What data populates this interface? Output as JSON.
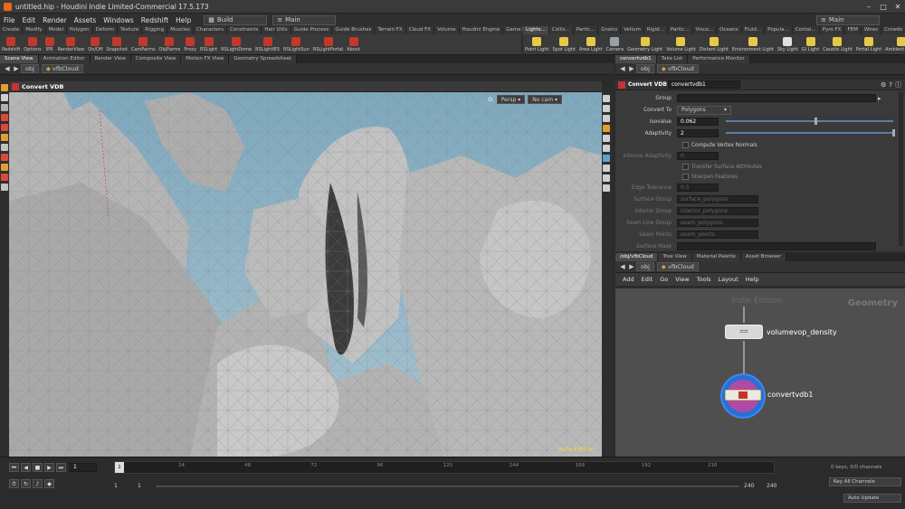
{
  "window": {
    "title": "untitled.hip - Houdini Indie Limited-Commercial 17.5.173",
    "min": "–",
    "max": "□",
    "close": "✕"
  },
  "menubar": {
    "items": [
      "File",
      "Edit",
      "Render",
      "Assets",
      "Windows",
      "Redshift",
      "Help"
    ],
    "desktop": "Build",
    "context_left": "Main",
    "context_right": "Main"
  },
  "shelf_left": {
    "tabs": [
      "Create",
      "Modify",
      "Model",
      "Polygon",
      "Deform",
      "Texture",
      "Rigging",
      "Muscles",
      "Characters",
      "Constraints",
      "Hair Utils",
      "Guide Process",
      "Guide Brushes",
      "Terrain FX",
      "Cloud FX",
      "Volume",
      "Houdini Engine",
      "Game Developme...",
      "Redshift"
    ],
    "tools": [
      {
        "label": "Redshift",
        "icon": "redshift-icon",
        "color": "#c0392b"
      },
      {
        "label": "Options",
        "icon": "options-icon",
        "color": "#c0392b"
      },
      {
        "label": "IPR",
        "icon": "ipr-icon",
        "color": "#c0392b"
      },
      {
        "label": "RenderView",
        "icon": "renderview-icon",
        "color": "#c0392b"
      },
      {
        "label": "On/Off",
        "icon": "onoff-icon",
        "color": "#c0392b"
      },
      {
        "label": "Snapshot",
        "icon": "snapshot-icon",
        "color": "#c0392b"
      },
      {
        "label": "CamParms",
        "icon": "camparms-icon",
        "color": "#c0392b"
      },
      {
        "label": "ObjParms",
        "icon": "objparms-icon",
        "color": "#c0392b"
      },
      {
        "label": "Proxy",
        "icon": "proxy-icon",
        "color": "#c0392b"
      },
      {
        "label": "RSLight",
        "icon": "rslight-icon",
        "color": "#c0392b"
      },
      {
        "label": "RSLightDome",
        "icon": "rslightdome-icon",
        "color": "#c0392b"
      },
      {
        "label": "RSLightIES",
        "icon": "rslighties-icon",
        "color": "#c0392b"
      },
      {
        "label": "RSLightSun",
        "icon": "rslightsun-icon",
        "color": "#c0392b"
      },
      {
        "label": "RSLightPortal",
        "icon": "rslightportal-icon",
        "color": "#c0392b"
      },
      {
        "label": "About",
        "icon": "about-icon",
        "color": "#c0392b"
      }
    ]
  },
  "shelf_right": {
    "tabs": [
      "Lights...",
      "Collis...",
      "Partic...",
      "Grains",
      "Vellum",
      "Rigid...",
      "Partic...",
      "Visco...",
      "Oceans",
      "Fluid...",
      "Popula...",
      "Contai...",
      "Pyro FX",
      "FEM",
      "Wires",
      "Crowds",
      "Drive"
    ],
    "tools": [
      {
        "label": "Point Light",
        "icon": "point-light-icon",
        "color": "#e6c84a"
      },
      {
        "label": "Spot Light",
        "icon": "spot-light-icon",
        "color": "#e6c84a"
      },
      {
        "label": "Area Light",
        "icon": "area-light-icon",
        "color": "#e6c84a"
      },
      {
        "label": "Camera",
        "icon": "camera-icon",
        "color": "#9aa0a6"
      },
      {
        "label": "Geometry Light",
        "icon": "geometry-light-icon",
        "color": "#e6c84a"
      },
      {
        "label": "Volume Light",
        "icon": "volume-light-icon",
        "color": "#e6c84a"
      },
      {
        "label": "Distant Light",
        "icon": "distant-light-icon",
        "color": "#e6c84a"
      },
      {
        "label": "Environment Light",
        "icon": "environment-light-icon",
        "color": "#e6c84a"
      },
      {
        "label": "Sky Light",
        "icon": "sky-light-icon",
        "color": "#e0e0e0"
      },
      {
        "label": "GI Light",
        "icon": "gi-light-icon",
        "color": "#e6c84a"
      },
      {
        "label": "Caustic Light",
        "icon": "caustic-light-icon",
        "color": "#e6c84a"
      },
      {
        "label": "Portal Light",
        "icon": "portal-light-icon",
        "color": "#e6c84a"
      },
      {
        "label": "Ambient Light",
        "icon": "ambient-light-icon",
        "color": "#e6c84a"
      },
      {
        "label": "Stereo Camera",
        "icon": "stereo-camera-icon",
        "color": "#9aa0a6"
      }
    ]
  },
  "left_pane": {
    "tabs": [
      "Scene View",
      "Animation Editor",
      "Render View",
      "Composite View",
      "Motion FX View",
      "Geometry Spreadsheet"
    ],
    "path": "obj",
    "node": "vfbCloud",
    "viewport_title": "Convert VDB",
    "persp": "Persp",
    "cam": "No cam",
    "watermark": "Indie Edition"
  },
  "params_pane": {
    "tabs": [
      "convertvdb1",
      "Take List",
      "Performance Monitor"
    ],
    "path": "obj",
    "node": "vfbCloud",
    "type_label": "Convert VDB",
    "node_name": "convertvdb1",
    "fields": {
      "group": {
        "label": "Group",
        "value": ""
      },
      "convert_to": {
        "label": "Convert To",
        "value": "Polygons"
      },
      "isovalue": {
        "label": "Isovalue",
        "value": "0.062"
      },
      "adaptivity": {
        "label": "Adaptivity",
        "value": "2"
      },
      "compute_vertex_normals": "Compute Vertex Normals",
      "internal_adaptivity": {
        "label": "Internal Adaptivity",
        "value": "0"
      },
      "transfer_surface_attributes": "Transfer Surface Attributes",
      "sharpen_features": "Sharpen Features",
      "edge_tolerance": {
        "label": "Edge Tolerance",
        "value": "0.5"
      },
      "surface_group": {
        "label": "Surface Group",
        "value": "surface_polygons"
      },
      "interior_group": {
        "label": "Interior Group",
        "value": "interior_polygons"
      },
      "seam_line_group": {
        "label": "Seam Line Group",
        "value": "seam_polygons"
      },
      "seam_points": {
        "label": "Seam Points",
        "value": "seam_points"
      },
      "surface_mask": {
        "label": "Surface Mask",
        "value": ""
      }
    }
  },
  "network_pane": {
    "tabs": [
      "/obj/vfbCloud",
      "Tree View",
      "Material Palette",
      "Asset Browser"
    ],
    "path": "obj",
    "node": "vfbCloud",
    "menu": [
      "Add",
      "Edit",
      "Go",
      "View",
      "Tools",
      "Layout",
      "Help"
    ],
    "watermark": "Indie Edition",
    "context_label": "Geometry",
    "nodes": [
      {
        "name": "volumevop_density"
      },
      {
        "name": "convertvdb1"
      }
    ]
  },
  "timeline": {
    "current_frame": "1",
    "ticks": [
      "1",
      "24",
      "48",
      "72",
      "96",
      "120",
      "144",
      "168",
      "192",
      "216"
    ],
    "start": "1",
    "start2": "1",
    "end": "240",
    "end2": "240",
    "keys_info": "0 keys, 0/0 channels",
    "key_all_channels": "Key All Channels",
    "auto_update": "Auto Update"
  },
  "colors": {
    "sky": "#8fb2c4",
    "mesh": "#b9b9b9",
    "node_selected": "#2a6fd6",
    "node_flag": "#d6c44a",
    "accent": "#e86a1c"
  }
}
